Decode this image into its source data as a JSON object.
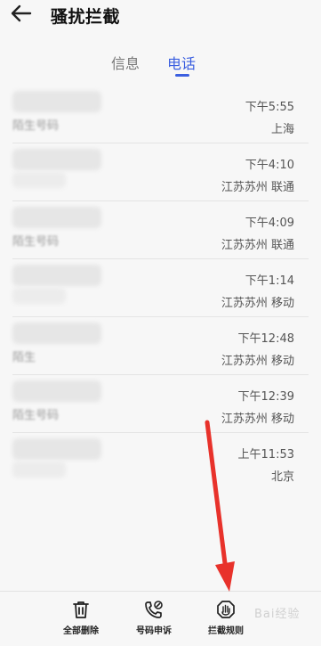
{
  "header": {
    "title": "骚扰拦截",
    "back_icon": "arrow-left-icon"
  },
  "tabs": [
    {
      "label": "信息",
      "active": false
    },
    {
      "label": "电话",
      "active": true
    }
  ],
  "accent_color": "#3b5fe0",
  "calls": [
    {
      "name_fragment": "陌生号码",
      "time": "下午5:55",
      "location": "上海"
    },
    {
      "name_fragment": "",
      "time": "下午4:10",
      "location": "江苏苏州 联通"
    },
    {
      "name_fragment": "陌生号码",
      "time": "下午4:09",
      "location": "江苏苏州 联通"
    },
    {
      "name_fragment": "",
      "time": "下午1:14",
      "location": "江苏苏州 移动"
    },
    {
      "name_fragment": "陌生",
      "time": "下午12:48",
      "location": "江苏苏州 移动"
    },
    {
      "name_fragment": "陌生号码",
      "time": "下午12:39",
      "location": "江苏苏州 移动"
    },
    {
      "name_fragment": "",
      "time": "上午11:53",
      "location": "北京"
    }
  ],
  "toolbar": {
    "delete_all_label": "全部删除",
    "delete_icon": "trash-icon",
    "appeal_label": "号码申诉",
    "appeal_icon": "phone-edit-icon",
    "rules_label": "拦截规则",
    "rules_icon": "hand-stop-icon"
  },
  "annotation": {
    "arrow_color": "#e8322b"
  },
  "watermark": "Bai经验"
}
